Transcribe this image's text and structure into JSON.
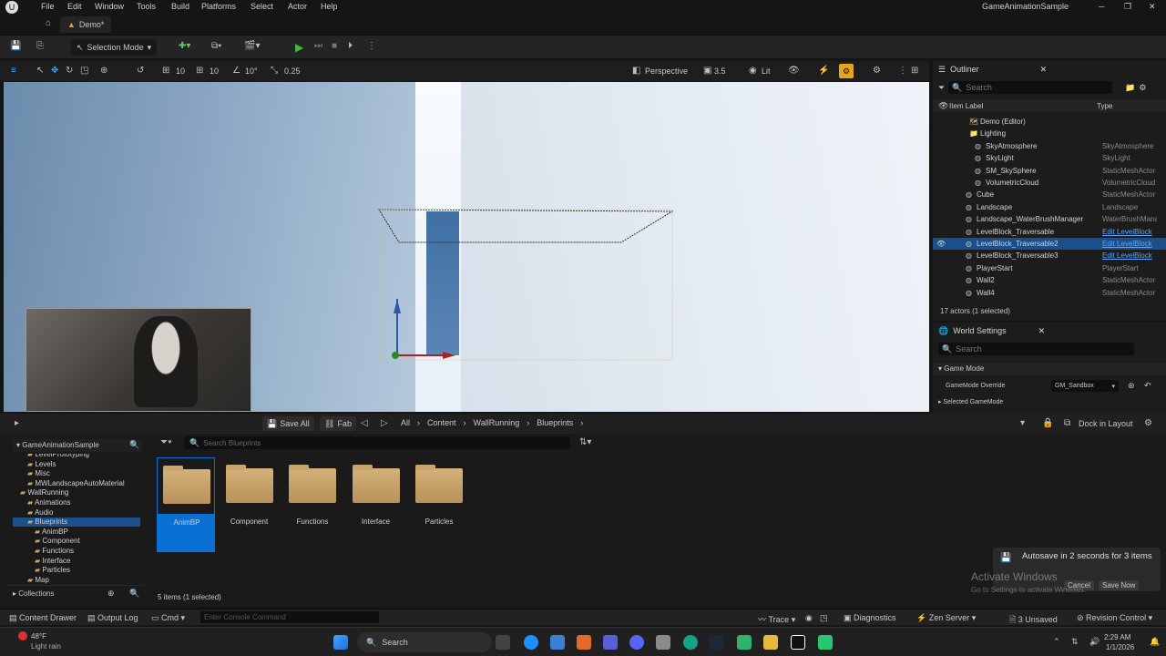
{
  "menubar": {
    "items": [
      "File",
      "Edit",
      "Window",
      "Tools",
      "Build",
      "Platforms",
      "Select",
      "Actor",
      "Help"
    ],
    "project": "GameAnimationSample"
  },
  "tab": {
    "label": "Demo*"
  },
  "toolbar": {
    "mode": "Selection Mode"
  },
  "viewport_toolbar": {
    "grid_snap": "10",
    "rotation_snap": "10°",
    "scale_snap": "0.25",
    "view": "Perspective",
    "camera_speed": "3.5",
    "lit": "Lit"
  },
  "outliner": {
    "title": "Outliner",
    "search_placeholder": "Search",
    "col_label": "Item Label",
    "col_type": "Type",
    "rows": [
      {
        "label": "Demo (Editor)",
        "type": ""
      },
      {
        "label": "Lighting",
        "type": ""
      },
      {
        "label": "SkyAtmosphere",
        "type": "SkyAtmosphere"
      },
      {
        "label": "SkyLight",
        "type": "SkyLight"
      },
      {
        "label": "SM_SkySphere",
        "type": "StaticMeshActor"
      },
      {
        "label": "VolumetricCloud",
        "type": "VolumetricCloud"
      },
      {
        "label": "Cube",
        "type": "StaticMeshActor"
      },
      {
        "label": "Landscape",
        "type": "Landscape"
      },
      {
        "label": "Landscape_WaterBrushManager",
        "type": "WaterBrushManager"
      },
      {
        "label": "LevelBlock_Traversable",
        "type": "Edit LevelBlock"
      },
      {
        "label": "LevelBlock_Traversable2",
        "type": "Edit LevelBlock"
      },
      {
        "label": "LevelBlock_Traversable3",
        "type": "Edit LevelBlock"
      },
      {
        "label": "PlayerStart",
        "type": "PlayerStart"
      },
      {
        "label": "Wall2",
        "type": "StaticMeshActor"
      },
      {
        "label": "Wall4",
        "type": "StaticMeshActor"
      }
    ],
    "count": "17 actors (1 selected)"
  },
  "world_settings": {
    "title": "World Settings",
    "search_placeholder": "Search",
    "section": "Game Mode",
    "override_label": "GameMode Override",
    "override_value": "GM_Sandbox",
    "selected_label": "Selected GameMode"
  },
  "content_browser": {
    "save_all": "Save All",
    "fab": "Fab",
    "path": [
      "All",
      "Content",
      "WallRunning",
      "Blueprints"
    ],
    "dock": "Dock in Layout",
    "root": "GameAnimationSample",
    "tree": [
      {
        "label": "LevelPrototyping",
        "indent": 2
      },
      {
        "label": "Levels",
        "indent": 2
      },
      {
        "label": "Misc",
        "indent": 2
      },
      {
        "label": "MWLandscapeAutoMaterial",
        "indent": 2
      },
      {
        "label": "WallRunning",
        "indent": 1
      },
      {
        "label": "Animations",
        "indent": 2
      },
      {
        "label": "Audio",
        "indent": 2
      },
      {
        "label": "Blueprints",
        "indent": 2
      },
      {
        "label": "AnimBP",
        "indent": 3
      },
      {
        "label": "Component",
        "indent": 3
      },
      {
        "label": "Functions",
        "indent": 3
      },
      {
        "label": "Interface",
        "indent": 3
      },
      {
        "label": "Particles",
        "indent": 3
      },
      {
        "label": "Map",
        "indent": 2
      }
    ],
    "search_placeholder": "Search Blueprints",
    "folders": [
      "AnimBP",
      "Component",
      "Functions",
      "Interface",
      "Particles"
    ],
    "collections": "Collections",
    "count": "5 items (1 selected)"
  },
  "autosave": {
    "message": "Autosave in 2 seconds for 3 items",
    "cancel": "Cancel",
    "save_now": "Save Now"
  },
  "activate": {
    "line1": "Activate Windows",
    "line2": "Go to Settings to activate Windows."
  },
  "statusbar": {
    "content_drawer": "Content Drawer",
    "output_log": "Output Log",
    "cmd": "Cmd",
    "console_placeholder": "Enter Console Command",
    "trace": "Trace",
    "diagnostics": "Diagnostics",
    "zen": "Zen Server",
    "unsaved": "3 Unsaved",
    "revision": "Revision Control"
  },
  "taskbar": {
    "temp": "48°F",
    "weather": "Light rain",
    "search": "Search",
    "time": "2:29 AM",
    "date": "1/1/2026"
  },
  "colors": {
    "accent": "#0a70d6",
    "play": "#3cbd3c"
  }
}
